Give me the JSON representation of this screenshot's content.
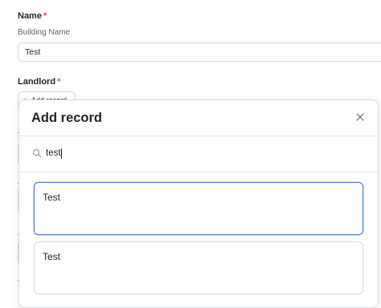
{
  "form": {
    "name_field": {
      "label": "Name",
      "required_marker": "*",
      "help": "Building Name",
      "value": "Test"
    },
    "landlord_field": {
      "label": "Landlord",
      "required_marker": "*",
      "add_button_label": "Add record",
      "add_button_icon": "plus-icon"
    }
  },
  "modal": {
    "title": "Add record",
    "close_icon": "close-icon",
    "search": {
      "icon": "search-icon",
      "value": "test"
    },
    "results": [
      {
        "label": "Test",
        "selected": true
      },
      {
        "label": "Test",
        "selected": false
      }
    ]
  },
  "colors": {
    "required": "#e5484d",
    "selected_border": "#4a7fd6",
    "border": "#d5d9de"
  }
}
